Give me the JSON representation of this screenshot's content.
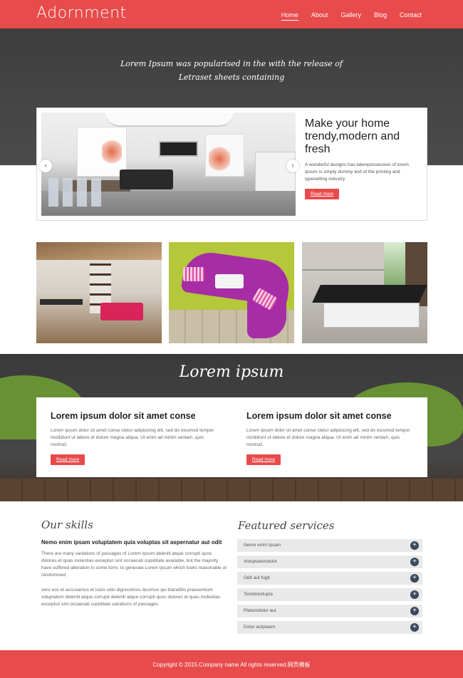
{
  "header": {
    "logo": "Adornment",
    "nav": [
      "Home",
      "About",
      "Gallery",
      "Blog",
      "Contact"
    ],
    "active_nav": "Home",
    "brand_color": "#e84b4b"
  },
  "hero": {
    "quote_line1": "Lorem Ipsum was popularised in the with the release of",
    "quote_line2": "Letraset sheets containing"
  },
  "slider": {
    "title": "Make your home trendy,modern and fresh",
    "text": "A wonderful designs has takenpossession of lorem Ipsum is simply dummy text of the printing and typesetting industry.",
    "button": "Read more",
    "prev_icon": "chevron-left-icon",
    "next_icon": "chevron-right-icon",
    "prev_glyph": "‹",
    "next_glyph": "›"
  },
  "band": {
    "title": "Lorem ipsum",
    "cards": [
      {
        "title": "Lorem ipsum dolor sit amet conse",
        "text": "Lorem ipsum dolor sit amet conse ctetur adipisicing elit, sed do eiusmod tempor incididunt ut labore et dolore magna aliqua. Ut enim ad minim veniam, quis nostrud.",
        "button": "Read more"
      },
      {
        "title": "Lorem ipsum dolor sit amet conse",
        "text": "Lorem ipsum dolor sit amet conse ctetur adipisicing elit, sed do eiusmod tempor incididunt ut labore et dolore magna aliqua. Ut enim ad minim veniam, quis nostrud.",
        "button": "Read more"
      }
    ]
  },
  "skills": {
    "title": "Our skills",
    "subtitle": "Nemo enim ipsam voluptatem quia voluptas sit aspernatur aut odit",
    "p1": "There are many variations of passages of Lorem Ipsum deleniti atque corrupti quos dolores et quas molestias exceptun sint occaecati cupiditate available, but the majority have suffered alteration in some form, to generate Lorem Ipsum which looks reasonable or randomised.",
    "p2": "vero eos et accusamus et iusto odio dignissimos ducimus qui blanditiis praesentium voluptatum deleniti atque corrupti deleniti atque corrupti quos dolores et quas molestias excepturi sint occaecati cupiditate variations of passages."
  },
  "services": {
    "title": "Featured services",
    "plus_icon": "plus-icon",
    "plus_glyph": "+",
    "items": [
      "Nemo enim ipsam",
      "Voluptatemdolor",
      "Odit aut fugit",
      "Temdolorlupta",
      "Platemdolor aut",
      "Dolor autptaem"
    ]
  },
  "footer": {
    "copyright": "Copyright © 2015.Company name All rights reserved.网页模板"
  }
}
